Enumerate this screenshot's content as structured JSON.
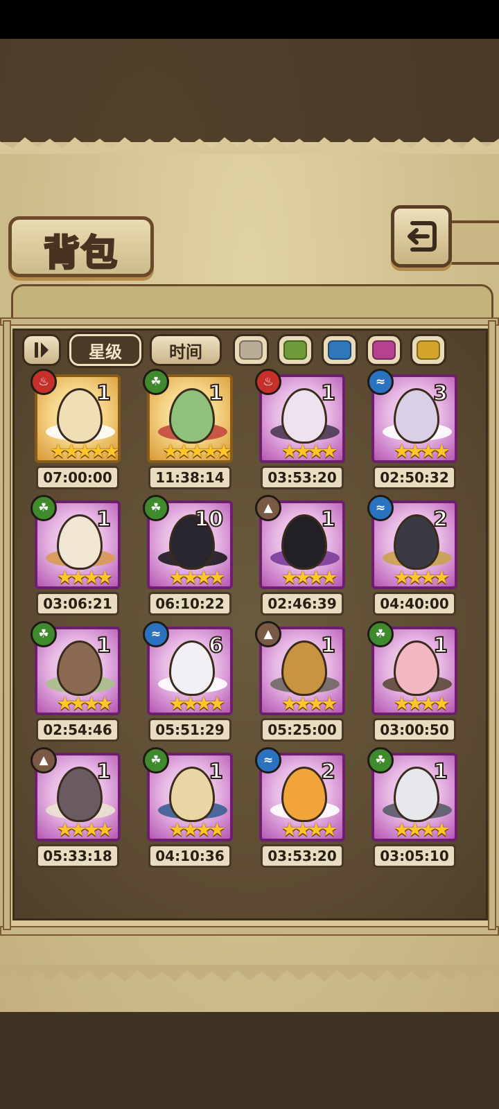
{
  "title": "背包",
  "filters": {
    "sort_icon": "sort-toggle-icon",
    "star_label": "星级",
    "time_label": "时间",
    "colors": [
      "#b9ad96",
      "#6e9a3a",
      "#2f77b8",
      "#b4428f",
      "#d2a42a"
    ]
  },
  "element_colors": {
    "fire": "#c6302a",
    "leaf": "#3f8a2c",
    "water": "#2b73c0",
    "earth": "#7a5a45"
  },
  "items": [
    {
      "count": "1",
      "stars": "★★★★★",
      "time": "07:00:00",
      "element": "fire",
      "rarity": "gold",
      "egg": "#f0dfb6",
      "decor": "#ffffff"
    },
    {
      "count": "1",
      "stars": "★★★★★",
      "time": "11:38:14",
      "element": "leaf",
      "rarity": "gold",
      "egg": "#8fc17a",
      "decor": "#c24a3e"
    },
    {
      "count": "1",
      "stars": "★★★★",
      "time": "03:53:20",
      "element": "fire",
      "rarity": "purple",
      "egg": "#ece3ee",
      "decor": "#4b3a55"
    },
    {
      "count": "3",
      "stars": "★★★★",
      "time": "02:50:32",
      "element": "water",
      "rarity": "purple",
      "egg": "#d9d0e6",
      "decor": "#ffffff"
    },
    {
      "count": "1",
      "stars": "★★★★",
      "time": "03:06:21",
      "element": "leaf",
      "rarity": "purple",
      "egg": "#efe6d3",
      "decor": "#d79a52"
    },
    {
      "count": "10",
      "stars": "★★★★",
      "time": "06:10:22",
      "element": "leaf",
      "rarity": "purple",
      "egg": "#2a2630",
      "decor": "#1c1a20"
    },
    {
      "count": "1",
      "stars": "★★★★",
      "time": "02:46:39",
      "element": "earth",
      "rarity": "purple",
      "egg": "#222026",
      "decor": "#7a3d9a"
    },
    {
      "count": "2",
      "stars": "★★★★",
      "time": "04:40:00",
      "element": "water",
      "rarity": "purple",
      "egg": "#3a3a44",
      "decor": "#c9a24c"
    },
    {
      "count": "1",
      "stars": "★★★★",
      "time": "02:54:46",
      "element": "leaf",
      "rarity": "purple",
      "egg": "#8a6a52",
      "decor": "#a9c08a"
    },
    {
      "count": "6",
      "stars": "★★★★",
      "time": "05:51:29",
      "element": "water",
      "rarity": "purple",
      "egg": "#f2f0f4",
      "decor": "#ffffff"
    },
    {
      "count": "1",
      "stars": "★★★★",
      "time": "05:25:00",
      "element": "earth",
      "rarity": "purple",
      "egg": "#c99442",
      "decor": "#6e6a62"
    },
    {
      "count": "1",
      "stars": "★★★★",
      "time": "03:00:50",
      "element": "leaf",
      "rarity": "purple",
      "egg": "#f3b8c2",
      "decor": "#5b4a3a"
    },
    {
      "count": "1",
      "stars": "★★★★",
      "time": "05:33:18",
      "element": "earth",
      "rarity": "purple",
      "egg": "#6a5a62",
      "decor": "#ece2cf"
    },
    {
      "count": "1",
      "stars": "★★★★",
      "time": "04:10:36",
      "element": "leaf",
      "rarity": "purple",
      "egg": "#ead6a4",
      "decor": "#3b5f93"
    },
    {
      "count": "2",
      "stars": "★★★★",
      "time": "03:53:20",
      "element": "water",
      "rarity": "purple",
      "egg": "#f0a43a",
      "decor": "#ffffff"
    },
    {
      "count": "1",
      "stars": "★★★★",
      "time": "03:05:10",
      "element": "leaf",
      "rarity": "purple",
      "egg": "#e7e7ee",
      "decor": "#5b5c68"
    }
  ]
}
